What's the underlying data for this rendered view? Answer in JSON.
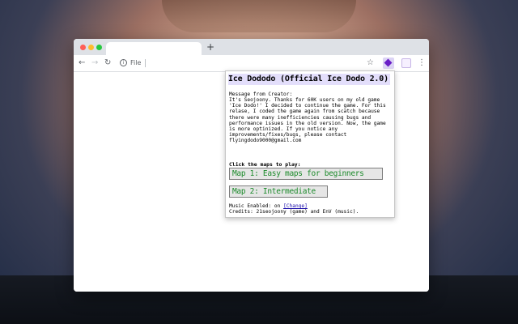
{
  "browser": {
    "new_tab_glyph": "+",
    "address_label": "File",
    "icons": {
      "back": "arrow-left-icon",
      "forward": "arrow-right-icon",
      "reload": "reload-icon",
      "info": "info-icon",
      "star": "star-icon",
      "extension": "purple-diamond-extension-icon",
      "menu": "kebab-menu-icon"
    },
    "window_controls": {
      "close": "#ff5f57",
      "minimize": "#febc2e",
      "maximize": "#28c840"
    }
  },
  "popup": {
    "title": "Ice Dododo (Official Ice Dodo 2.0)",
    "message_heading": "Message from Creator:",
    "message_body": "It's Seojoony. Thanks for 60K users on my old game 'Ice Dodo!' I decided to continue the game. For this relase, I coded the game again from scatch because there were many inefficiencies causing bugs and performance issues in the old version. Now, the game is more optinized. If you notice any improvements/fixes/bugs, please contact flyingdodo9000@gmail.com",
    "click_heading": "Click the maps to play:",
    "map_buttons": [
      {
        "label": "Map 1: Easy maps for beginners"
      },
      {
        "label": "Map 2: Intermediate"
      }
    ],
    "music_prefix": "Music Enabled: on ",
    "music_change_link": "[Change]",
    "credits": "Credits: 21seojoony (game) and EnV (music).",
    "colors": {
      "title_bg": "#e3defb",
      "button_text": "#1b8a2a",
      "button_bg": "#e6e6e6"
    }
  }
}
